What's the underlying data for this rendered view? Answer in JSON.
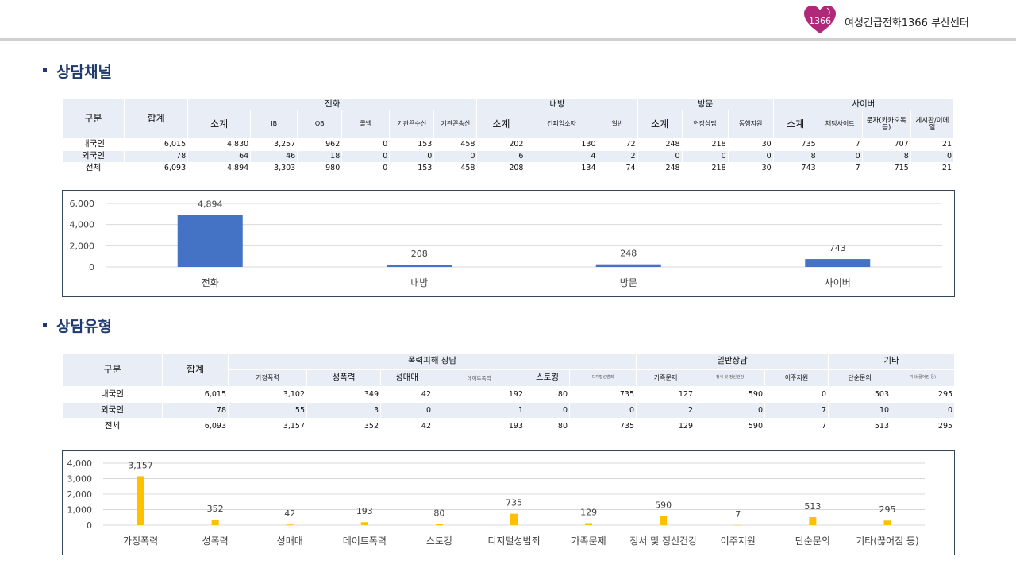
{
  "header": {
    "org_name": "여성긴급전화1366 부산센터",
    "logo_text": "1366"
  },
  "sections": {
    "channel_title": "상담채널",
    "type_title": "상담유형"
  },
  "table1": {
    "col_label": "구분",
    "total_label": "합계",
    "groups": [
      "전화",
      "내방",
      "방문",
      "사이버"
    ],
    "sub": {
      "phone_subtotal": "소계",
      "phone_ib": "IB",
      "phone_ob": "OB",
      "phone_callback": "콜백",
      "phone_agency_in": "기관끈수신",
      "phone_agency_out": "기관끈송신",
      "visit_subtotal": "소계",
      "visit_emergency": "긴피입소자",
      "visit_general": "일반",
      "outreach_subtotal": "소계",
      "outreach_onsite": "현장상담",
      "outreach_accompany": "동행지원",
      "cyber_subtotal": "소계",
      "cyber_chat": "채팅사이트",
      "cyber_sms": "문자(카카오톡등)",
      "cyber_board": "게시판/이메일"
    },
    "rows": [
      {
        "label": "내국인",
        "values": [
          "6,015",
          "4,830",
          "3,257",
          "962",
          "0",
          "153",
          "458",
          "202",
          "130",
          "72",
          "248",
          "218",
          "30",
          "735",
          "7",
          "707",
          "21"
        ]
      },
      {
        "label": "외국인",
        "values": [
          "78",
          "64",
          "46",
          "18",
          "0",
          "0",
          "0",
          "6",
          "4",
          "2",
          "0",
          "0",
          "0",
          "8",
          "0",
          "8",
          "0"
        ]
      },
      {
        "label": "전체",
        "values": [
          "6,093",
          "4,894",
          "3,303",
          "980",
          "0",
          "153",
          "458",
          "208",
          "134",
          "74",
          "248",
          "218",
          "30",
          "743",
          "7",
          "715",
          "21"
        ]
      }
    ]
  },
  "table2": {
    "col_label": "구분",
    "total_label": "합계",
    "groups": [
      "폭력피해 상담",
      "일반상담",
      "기타"
    ],
    "sub": {
      "domestic": "가정폭력",
      "sexual": "성폭력",
      "prostitution": "성매매",
      "dating": "데이트폭력",
      "stalking": "스토킹",
      "digital": "디지털성범죄",
      "family": "가족문제",
      "mental": "정서 및 정신건강",
      "migrant": "이주지원",
      "simple": "단순문의",
      "etc": "기타(끊어짐 등)"
    },
    "rows": [
      {
        "label": "내국인",
        "values": [
          "6,015",
          "3,102",
          "349",
          "42",
          "192",
          "80",
          "735",
          "127",
          "590",
          "0",
          "503",
          "295"
        ]
      },
      {
        "label": "외국인",
        "values": [
          "78",
          "55",
          "3",
          "0",
          "1",
          "0",
          "0",
          "2",
          "0",
          "7",
          "10",
          "0"
        ]
      },
      {
        "label": "전체",
        "values": [
          "6,093",
          "3,157",
          "352",
          "42",
          "193",
          "80",
          "735",
          "129",
          "590",
          "7",
          "513",
          "295"
        ]
      }
    ]
  },
  "chart_data": [
    {
      "type": "bar",
      "categories": [
        "전화",
        "내방",
        "방문",
        "사이버"
      ],
      "values": [
        4894,
        208,
        248,
        743
      ],
      "data_labels": [
        "4,894",
        "208",
        "248",
        "743"
      ],
      "ylim": [
        0,
        6000
      ],
      "yticks": [
        "0",
        "2,000",
        "4,000",
        "6,000"
      ],
      "color": "#4472c4",
      "grid": true
    },
    {
      "type": "bar",
      "categories": [
        "가정폭력",
        "성폭력",
        "성매매",
        "데이트폭력",
        "스토킹",
        "디지털성범죄",
        "가족문제",
        "정서 및 정신건강",
        "이주지원",
        "단순문의",
        "기타(끊어짐 등)"
      ],
      "values": [
        3157,
        352,
        42,
        193,
        80,
        735,
        129,
        590,
        7,
        513,
        295
      ],
      "data_labels": [
        "3,157",
        "352",
        "42",
        "193",
        "80",
        "735",
        "129",
        "590",
        "7",
        "513",
        "295"
      ],
      "ylim": [
        0,
        4000
      ],
      "yticks": [
        "0",
        "1,000",
        "2,000",
        "3,000",
        "4,000"
      ],
      "color": "#ffc000",
      "grid": true
    }
  ]
}
